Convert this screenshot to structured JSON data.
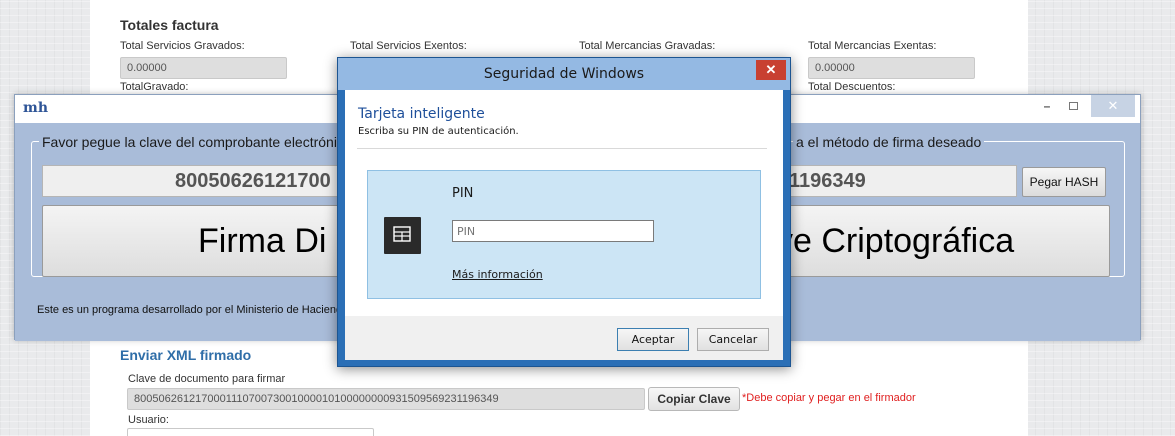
{
  "webpage": {
    "section_title": "Totales factura",
    "fields": [
      {
        "label": "Total Servicios Gravados:",
        "value": "0.00000"
      },
      {
        "label": "Total Servicios Exentos:",
        "value": ""
      },
      {
        "label": "Total Mercancias Gravadas:",
        "value": ""
      },
      {
        "label": "Total Mercancias Exentas:",
        "value": "0.00000"
      }
    ],
    "total_gravado_label": "TotalGravado:",
    "total_descuentos_label": "Total Descuentos:",
    "send_section_title": "Enviar XML firmado",
    "doc_key_label": "Clave de documento para firmar",
    "doc_key_value": "80050626121700011107007300100001010000000093150956923119634​9",
    "copy_button": "Copiar Clave",
    "copy_warning": "*Debe copiar y pegar en el firmador",
    "user_label": "Usuario:"
  },
  "app": {
    "logo": "mh",
    "minimize_glyph": "–",
    "close_glyph": "✕",
    "legend_left": "Favor pegue la clave del comprobante electróni",
    "legend_right": "a el método de firma deseado",
    "hash_left": "80050626121700",
    "hash_right": "11196349",
    "paste_button": "Pegar HASH",
    "sign_left": "Firma Di",
    "sign_right": "ve Criptográfica",
    "footer": "Este es un programa desarrollado por el Ministerio de Haciend"
  },
  "dialog": {
    "title": "Seguridad de Windows",
    "close_glyph": "✕",
    "heading": "Tarjeta inteligente",
    "subheading": "Escriba su PIN de autenticación.",
    "pin_label": "PIN",
    "pin_placeholder": "PIN",
    "more_info": "Más información",
    "ok_button": "Aceptar",
    "cancel_button": "Cancelar"
  }
}
